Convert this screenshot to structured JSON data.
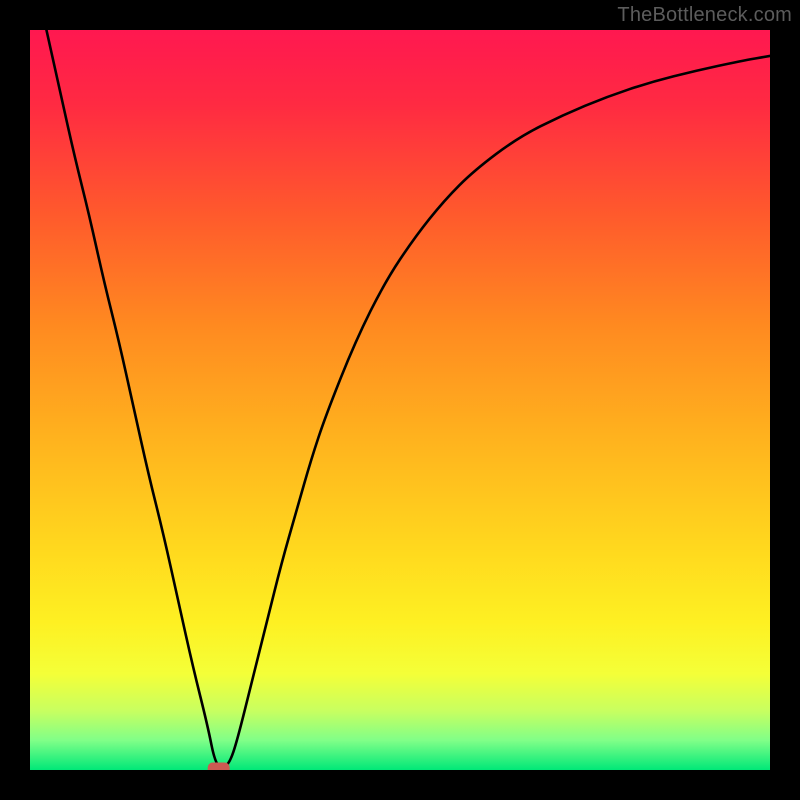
{
  "watermark": "TheBottleneck.com",
  "chart_data": {
    "type": "line",
    "title": "",
    "xlabel": "",
    "ylabel": "",
    "xlim": [
      0,
      100
    ],
    "ylim": [
      0,
      100
    ],
    "grid": false,
    "series": [
      {
        "name": "bottleneck-curve",
        "x": [
          0,
          2,
          4,
          6,
          8,
          10,
          12,
          14,
          16,
          18,
          20,
          22,
          24,
          25,
          26,
          27,
          28,
          30,
          32,
          34,
          36,
          38,
          40,
          44,
          48,
          52,
          56,
          60,
          66,
          72,
          78,
          84,
          90,
          96,
          100
        ],
        "y": [
          110,
          101,
          92,
          83,
          75,
          66,
          58,
          49,
          40,
          32,
          23,
          14,
          6,
          1,
          0.2,
          1,
          4,
          12,
          20,
          28,
          35,
          42,
          48,
          58,
          66,
          72,
          77,
          81,
          85.5,
          88.5,
          91,
          93,
          94.5,
          95.8,
          96.5
        ]
      }
    ],
    "marker": {
      "name": "minimum-point",
      "x": 25.5,
      "y": 0.2,
      "color": "#cc5a52"
    },
    "gradient_stops": [
      {
        "offset": 0.0,
        "color": "#ff1850"
      },
      {
        "offset": 0.1,
        "color": "#ff2a42"
      },
      {
        "offset": 0.25,
        "color": "#ff5a2c"
      },
      {
        "offset": 0.4,
        "color": "#ff8a20"
      },
      {
        "offset": 0.55,
        "color": "#ffb21e"
      },
      {
        "offset": 0.7,
        "color": "#ffd81e"
      },
      {
        "offset": 0.8,
        "color": "#fef022"
      },
      {
        "offset": 0.87,
        "color": "#f4ff38"
      },
      {
        "offset": 0.92,
        "color": "#c8ff60"
      },
      {
        "offset": 0.96,
        "color": "#80ff88"
      },
      {
        "offset": 1.0,
        "color": "#00e878"
      }
    ]
  }
}
